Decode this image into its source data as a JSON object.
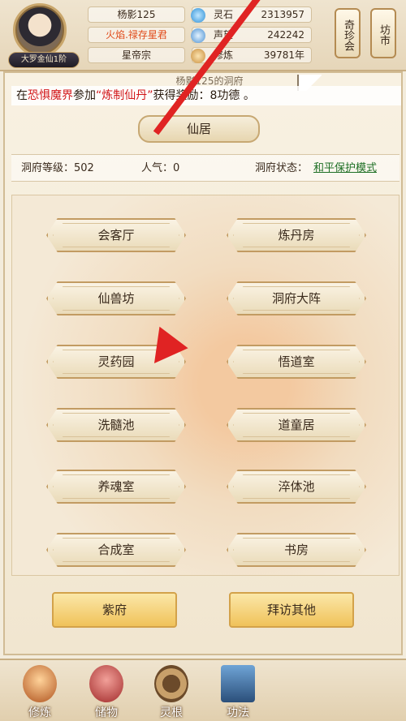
{
  "header": {
    "avatar_rank": "大罗金仙1阶",
    "player_name": "杨影125",
    "title_prefix": "火焰.",
    "title_suffix": "禄存星君",
    "sect": "星帝宗",
    "stats": [
      {
        "label": "灵石",
        "value": "2313957",
        "icon": "spirit-stone-icon"
      },
      {
        "label": "声望",
        "value": "242242",
        "icon": "reputation-icon"
      },
      {
        "label": "修炼",
        "value": "39781年",
        "icon": "cultivation-icon"
      }
    ],
    "side_buttons": [
      "奇珍会",
      "坊市"
    ]
  },
  "panel": {
    "cave_title": "杨影125的洞府",
    "notice": {
      "p1": "在",
      "place": "恐惧魔界",
      "p2": "参加",
      "event": "“炼制仙丹”",
      "p3": "获得奖励：8功德 。"
    },
    "home_tab": "仙居",
    "status": {
      "level_label": "洞府等级：502",
      "popularity_label": "人气：0",
      "state_label": "洞府状态：",
      "state_value": "和平保护模式"
    },
    "rooms": [
      "会客厅",
      "炼丹房",
      "仙兽坊",
      "洞府大阵",
      "灵药园",
      "悟道室",
      "洗髓池",
      "道童居",
      "养魂室",
      "淬体池",
      "合成室",
      "书房"
    ],
    "actions": [
      "紫府",
      "拜访其他"
    ]
  },
  "bottom_nav": [
    {
      "label": "修炼",
      "icon": "cultivate-icon"
    },
    {
      "label": "储物",
      "icon": "storage-bag-icon"
    },
    {
      "label": "灵根",
      "icon": "spirit-root-icon"
    },
    {
      "label": "功法",
      "icon": "technique-book-icon"
    }
  ],
  "colors": {
    "accent_red": "#d2171a",
    "arrow_red": "#e02323",
    "link_green": "#1e6f24",
    "gold": "#f0c25a"
  }
}
